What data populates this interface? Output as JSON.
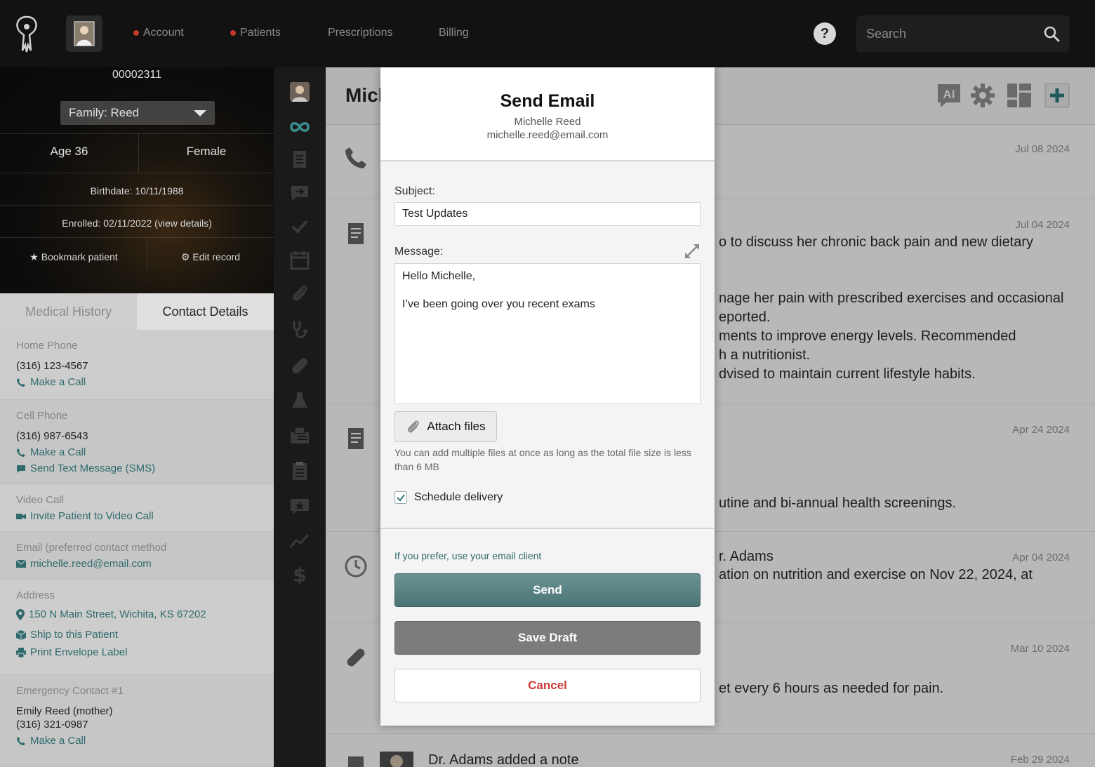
{
  "topbar": {
    "nav": [
      {
        "label": "Account",
        "has_dot": true
      },
      {
        "label": "Patients",
        "has_dot": true
      },
      {
        "label": "Prescriptions",
        "has_dot": false
      },
      {
        "label": "Billing",
        "has_dot": false
      }
    ],
    "help_label": "?",
    "search_placeholder": "Search"
  },
  "patient": {
    "id": "00002311",
    "family": "Family: Reed",
    "age": "Age 36",
    "gender": "Female",
    "birthdate": "Birthdate: 10/11/1988",
    "enrolled": "Enrolled: 02/11/2022 (view details)",
    "bookmark_label": "Bookmark patient",
    "edit_label": "Edit record"
  },
  "tabs": {
    "medical": "Medical History",
    "contact": "Contact Details"
  },
  "contacts": {
    "home_label": "Home Phone",
    "home_value": "(316) 123-4567",
    "home_call": "Make a Call",
    "cell_label": "Cell Phone",
    "cell_value": "(316) 987-6543",
    "cell_call": "Make a Call",
    "cell_sms": "Send Text Message (SMS)",
    "video_label": "Video Call",
    "video_invite": "Invite Patient to Video Call",
    "email_label": "Email (preferred contact method",
    "email_value": "michelle.reed@email.com",
    "address_label": "Address",
    "address_value": "150 N Main Street, Wichita, KS 67202",
    "ship": "Ship to this Patient",
    "envelope": "Print Envelope Label",
    "emergency_label": "Emergency Contact #1",
    "emergency_name": "Emily Reed (mother)",
    "emergency_phone": "(316) 321-0987",
    "emergency_call": "Make a Call"
  },
  "main": {
    "title": "Mich",
    "feed": [
      {
        "date": "Jul 08 2024",
        "lines": []
      },
      {
        "date": "Jul 04 2024",
        "lines": [
          "o to discuss her chronic back pain and new dietary",
          "nage her pain with prescribed exercises and occasional",
          "eported.",
          "ments to improve energy levels. Recommended",
          "h a nutritionist.",
          "dvised to maintain current lifestyle habits."
        ]
      },
      {
        "date": "Apr 24 2024",
        "lines": [
          "utine and bi-annual health screenings."
        ]
      },
      {
        "date": "Apr 04 2024",
        "lines": [
          "r. Adams",
          "ation on nutrition and exercise on Nov 22, 2024, at"
        ]
      },
      {
        "date": "Mar 10 2024",
        "lines": [
          "et every 6 hours as needed for pain."
        ]
      },
      {
        "date": "Feb 29 2024",
        "lines": [
          "Dr. Adams added a note"
        ]
      }
    ]
  },
  "modal": {
    "title": "Send Email",
    "recipient_name": "Michelle Reed",
    "recipient_email": "michelle.reed@email.com",
    "subject_label": "Subject:",
    "subject_value": "Test Updates",
    "message_label": "Message:",
    "message_value": "Hello Michelle,\n\nI’ve been going over you recent exams",
    "attach_label": "Attach files",
    "attach_help": "You can add multiple files at once as long as the total file size is less than 6 MB",
    "schedule_label": "Schedule delivery",
    "schedule_checked": true,
    "email_client_link": "If you prefer, use your email client",
    "send_label": "Send",
    "draft_label": "Save Draft",
    "cancel_label": "Cancel"
  },
  "colors": {
    "accent": "#2f6a6c",
    "send_button": "#5a8384",
    "cancel_text": "#cc3b3b",
    "status_dot": "#c0392b"
  },
  "icons": {
    "rail": [
      "patient-avatar",
      "infinity-icon",
      "notes-icon",
      "message-forward-icon",
      "check-icon",
      "calendar-icon",
      "paperclip-icon",
      "stethoscope-icon",
      "pill-icon",
      "flask-icon",
      "fax-icon",
      "clipboard-icon",
      "star-message-icon",
      "chart-icon",
      "dollar-icon"
    ],
    "header": [
      "ai-icon",
      "gear-icon",
      "dashboard-icon",
      "plus-icon"
    ]
  }
}
